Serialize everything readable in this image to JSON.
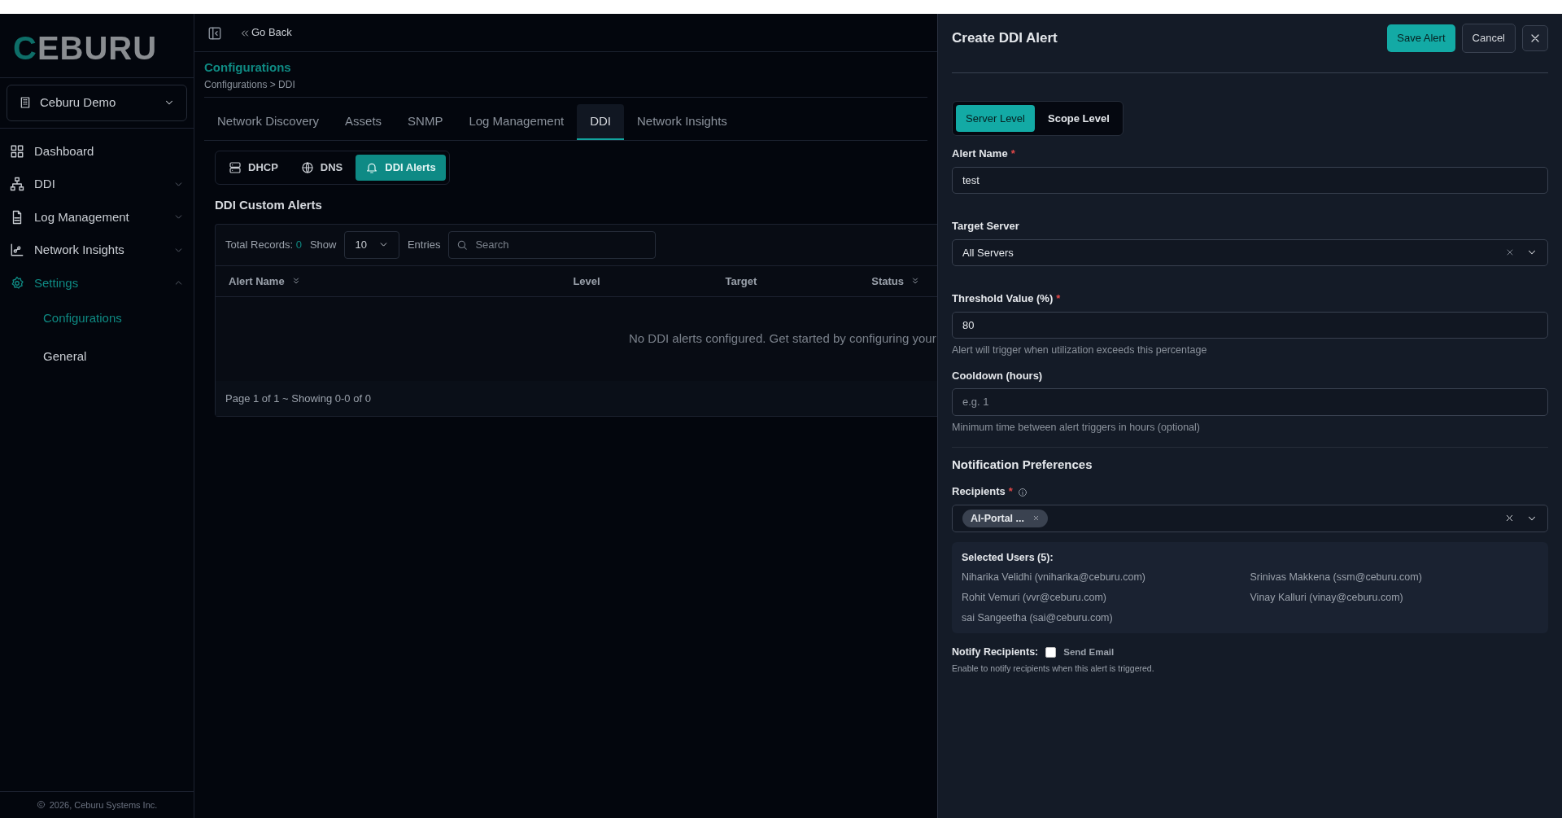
{
  "sidebar": {
    "logo": "CEBURU",
    "org_selector": "Ceburu Demo",
    "items": [
      {
        "label": "Dashboard",
        "selected": false
      },
      {
        "label": "DDI",
        "selected": false,
        "expanded": false
      },
      {
        "label": "Log Management",
        "selected": false,
        "expanded": false
      },
      {
        "label": "Network Insights",
        "selected": false,
        "expanded": false
      },
      {
        "label": "Settings",
        "selected": true,
        "expanded": true,
        "children": [
          {
            "label": "Configurations",
            "selected": true
          },
          {
            "label": "General",
            "selected": false
          }
        ]
      }
    ],
    "footer": "2026, Ceburu Systems Inc."
  },
  "header": {
    "go_back": "Go Back"
  },
  "page": {
    "title": "Configurations",
    "breadcrumb": "Configurations > DDI",
    "tabs": [
      {
        "label": "Network Discovery",
        "selected": false
      },
      {
        "label": "Assets",
        "selected": false
      },
      {
        "label": "SNMP",
        "selected": false
      },
      {
        "label": "Log Management",
        "selected": false
      },
      {
        "label": "DDI",
        "selected": true
      },
      {
        "label": "Network Insights",
        "selected": false
      }
    ],
    "subtabs": [
      {
        "label": "DHCP",
        "selected": false
      },
      {
        "label": "DNS",
        "selected": false
      },
      {
        "label": "DDI Alerts",
        "selected": true
      }
    ],
    "section_title": "DDI Custom Alerts",
    "table": {
      "total_label": "Total Records:",
      "total": "0",
      "show": "Show",
      "page_size": "10",
      "entries": "Entries",
      "search_placeholder": "Search",
      "columns": [
        {
          "label": "Alert Name",
          "sortable": true
        },
        {
          "label": "Level",
          "sortable": false
        },
        {
          "label": "Target",
          "sortable": false
        },
        {
          "label": "Status",
          "sortable": true
        }
      ],
      "empty": "No DDI alerts configured. Get started by configuring your",
      "footer": "Page 1 of 1 ~ Showing 0-0 of 0"
    }
  },
  "panel": {
    "required_mark": "*",
    "title": "Create DDI Alert",
    "save": "Save Alert",
    "cancel": "Cancel",
    "levels": [
      {
        "label": "Server Level",
        "selected": true
      },
      {
        "label": "Scope Level",
        "selected": false
      }
    ],
    "fields": [
      {
        "kind": "text",
        "label": "Alert Name",
        "required": true,
        "value": "test"
      },
      {
        "kind": "select",
        "label": "Target Server",
        "required": false,
        "value": "All Servers"
      },
      {
        "kind": "text",
        "label": "Threshold Value (%)",
        "required": true,
        "value": "80",
        "help": "Alert will trigger when utilization exceeds this percentage"
      },
      {
        "kind": "text",
        "label": "Cooldown (hours)",
        "required": false,
        "placeholder": "e.g. 1",
        "help": "Minimum time between alert triggers in hours (optional)"
      }
    ],
    "notification_title": "Notification Preferences",
    "recipients": {
      "label": "Recipients",
      "required": true,
      "tags": [
        "AI-Portal ..."
      ]
    },
    "selected_users": {
      "title": "Selected Users (5):",
      "users": [
        "Niharika Velidhi (vniharika@ceburu.com)",
        "Srinivas Makkena (ssm@ceburu.com)",
        "Rohit Vemuri (vvr@ceburu.com)",
        "Vinay Kalluri (vinay@ceburu.com)",
        "sai Sangeetha (sai@ceburu.com)"
      ]
    },
    "notify": {
      "label": "Notify Recipients:",
      "option": "Send Email",
      "checked": false,
      "note": "Enable to notify recipients when this alert is triggered."
    }
  }
}
